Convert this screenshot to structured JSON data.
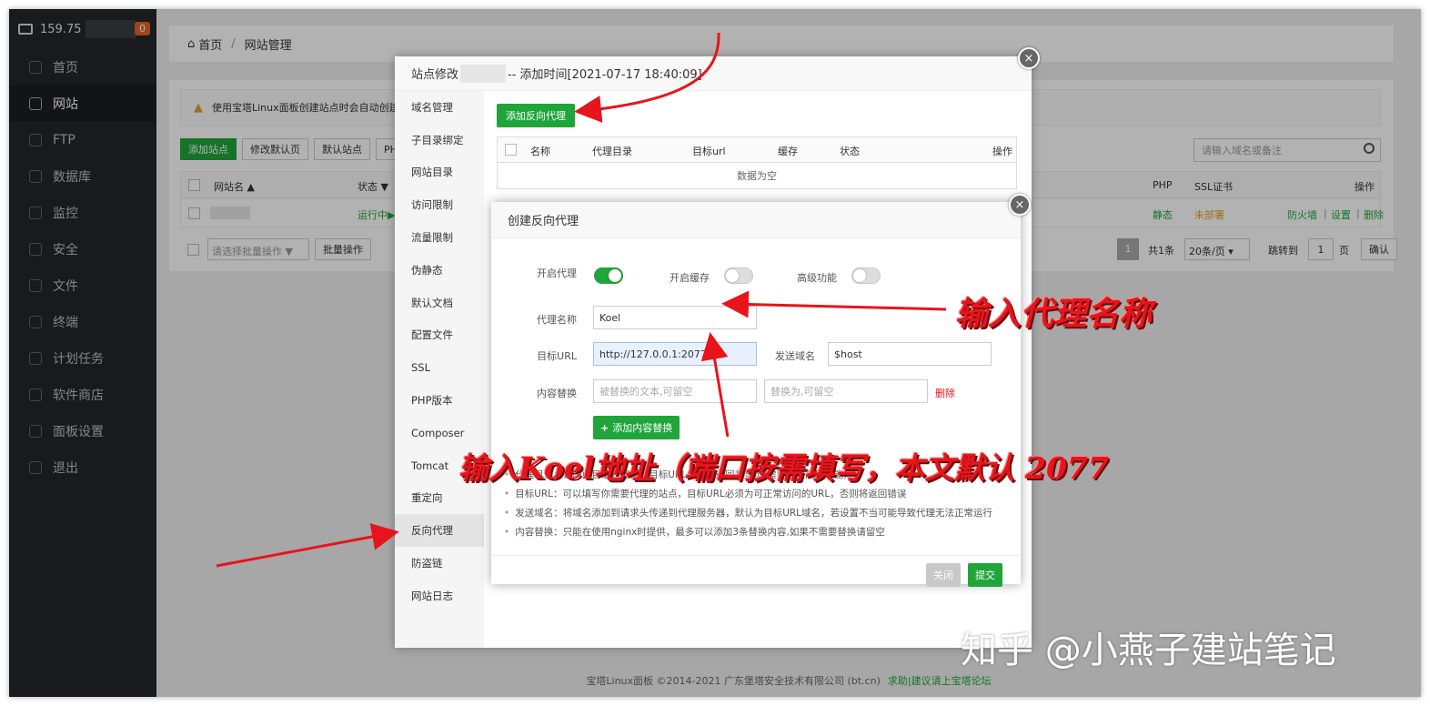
{
  "sidebar": {
    "ip": "159.75",
    "badge": "0",
    "items": [
      {
        "label": "首页"
      },
      {
        "label": "网站"
      },
      {
        "label": "FTP"
      },
      {
        "label": "数据库"
      },
      {
        "label": "监控"
      },
      {
        "label": "安全"
      },
      {
        "label": "文件"
      },
      {
        "label": "终端"
      },
      {
        "label": "计划任务"
      },
      {
        "label": "软件商店"
      },
      {
        "label": "面板设置"
      },
      {
        "label": "退出"
      }
    ]
  },
  "breadcrumb": {
    "home": "首页",
    "sep": "/",
    "current": "网站管理"
  },
  "notice": "使用宝塔Linux面板创建站点时会自动创建",
  "toolbar": {
    "add_site": "添加站点",
    "modify_default": "修改默认页",
    "default_site": "默认站点",
    "php": "PH"
  },
  "search_placeholder": "请输入域名或备注",
  "table": {
    "headers": {
      "name": "网站名 ▲",
      "status": "状态 ▼",
      "php": "PHP",
      "ssl": "SSL证书",
      "ops": "操作"
    },
    "row": {
      "status": "运行中▶",
      "php": "静态",
      "ssl": "未部署",
      "op1": "防火墙",
      "op2": "设置",
      "op3": "删除",
      "sep": "|"
    }
  },
  "pager": {
    "batch_select": "请选择批量操作",
    "batch_btn": "批量操作",
    "page": "1",
    "total": "共1条",
    "per_page": "20条/页",
    "jump": "跳转到",
    "jump_val": "1",
    "page_unit": "页",
    "confirm": "确认"
  },
  "footer": {
    "copyright": "宝塔Linux面板 ©2014-2021 广东堡塔安全技术有限公司 (bt.cn)",
    "link": "求助|建议请上宝塔论坛"
  },
  "site_modal": {
    "title_prefix": "站点修改",
    "title_suffix": "-- 添加时间[2021-07-17 18:40:09]",
    "tabs": [
      "域名管理",
      "子目录绑定",
      "网站目录",
      "访问限制",
      "流量限制",
      "伪静态",
      "默认文档",
      "配置文件",
      "SSL",
      "PHP版本",
      "Composer",
      "Tomcat",
      "重定向",
      "反向代理",
      "防盗链",
      "网站日志"
    ],
    "add_proxy": "添加反向代理",
    "proxy_table": {
      "name": "名称",
      "dir": "代理目录",
      "url": "目标url",
      "cache": "缓存",
      "status": "状态",
      "ops": "操作",
      "empty": "数据为空"
    },
    "close": "×"
  },
  "proxy_modal": {
    "title": "创建反向代理",
    "close": "×",
    "enable_proxy": "开启代理",
    "enable_cache": "开启缓存",
    "advanced": "高级功能",
    "name_label": "代理名称",
    "name_value": "Koel",
    "url_label": "目标URL",
    "url_value": "http://127.0.0.1:2077",
    "host_label": "发送域名",
    "host_value": "$host",
    "replace_label": "内容替换",
    "replace_from_ph": "被替换的文本,可留空",
    "replace_to_ph": "替换为,可留空",
    "delete": "删除",
    "add_replace": "添加内容替换",
    "notes": [
      "代理目录：访问此目录时将会把目标URL的内容返回并显示(需要开启高级功能)",
      "目标URL：可以填写你需要代理的站点，目标URL必须为可正常访问的URL，否则将返回错误",
      "发送域名：将域名添加到请求头传递到代理服务器，默认为目标URL域名，若设置不当可能导致代理无法正常运行",
      "内容替换：只能在使用nginx时提供，最多可以添加3条替换内容,如果不需要替换请留空"
    ],
    "cancel": "关闭",
    "submit": "提交"
  },
  "annotations": {
    "name_hint": "输入代理名称",
    "url_hint": "输入Koel地址（端口按需填写，本文默认 2077"
  },
  "watermark": "知乎 @小燕子建站笔记",
  "colors": {
    "brand_green": "#20a53a",
    "sidebar_bg": "#23262b",
    "annotation_red": "#e8141c",
    "warn_orange": "#e0652a"
  }
}
